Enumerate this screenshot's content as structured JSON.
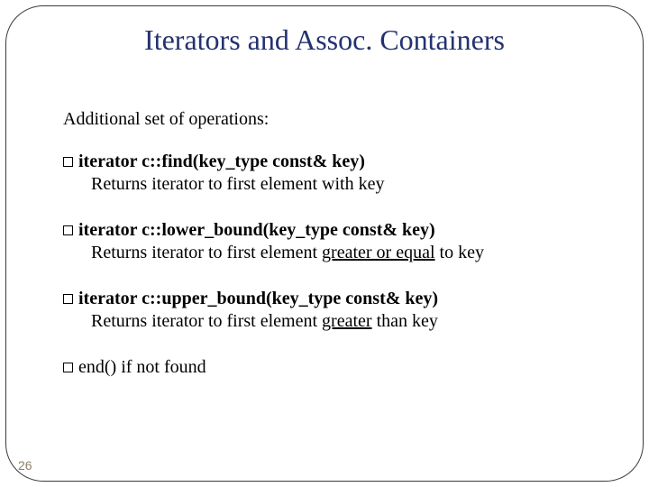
{
  "title": "Iterators and Assoc. Containers",
  "intro": "Additional set of operations:",
  "items": [
    {
      "signature": "iterator c::find(key_type const& key)",
      "desc_pre": "Returns iterator to first element with key",
      "desc_u": "",
      "desc_post": ""
    },
    {
      "signature": "iterator c::lower_bound(key_type const& key)",
      "desc_pre": "Returns iterator to first element ",
      "desc_u": "greater or equal",
      "desc_post": " to key"
    },
    {
      "signature": "iterator c::upper_bound(key_type const& key)",
      "desc_pre": "Returns iterator to first element ",
      "desc_u": "greater",
      "desc_post": " than key"
    }
  ],
  "end_signature": "end()",
  "end_rest": "  if not found",
  "page_number": "26"
}
